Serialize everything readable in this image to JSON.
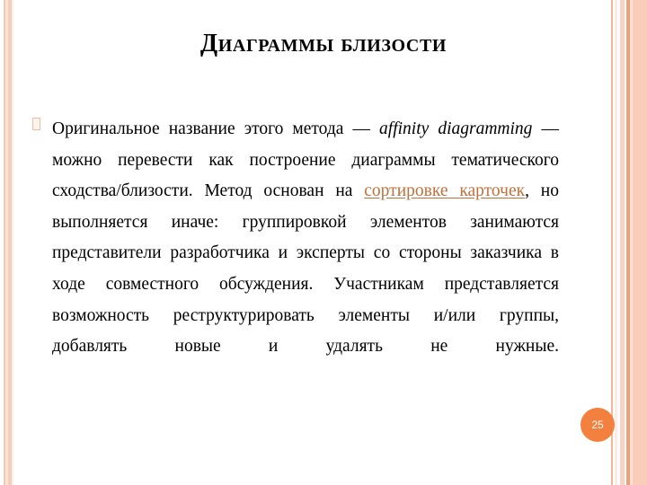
{
  "slide": {
    "title": "Диаграммы близости",
    "page_number": "25",
    "accent_color": "#f4803f",
    "link_color": "#c0703c",
    "stripe_color": "#f9cdb9",
    "background_color": "#ffffff"
  },
  "bullet": {
    "icon": "square-bullet-icon",
    "glyph": "❑",
    "color": "#f0bb9e"
  },
  "content": {
    "segments": [
      {
        "text": "Оригинальное название этого метода — ",
        "style": "normal"
      },
      {
        "text": "affinity diagramming",
        "style": "italic"
      },
      {
        "text": " — можно перевести как построение диаграммы тематического сходства/близости. Метод основан на ",
        "style": "normal"
      },
      {
        "text": "сортировке карточек",
        "style": "link"
      },
      {
        "text": ", но выполняется иначе: группировкой элементов занимаются представители разработчика и эксперты со стороны заказчика в ходе совместного обсуждения. Участникам представляется возможность реструктурировать элементы и/или группы, добавлять новые и удалять не нужные.",
        "style": "normal"
      }
    ],
    "plain_text": "Оригинальное название этого метода — affinity diagramming — можно перевести как построение диаграммы тематического сходства/близости. Метод основан на сортировке карточек, но выполняется иначе: группировкой элементов занимаются представители разработчика и эксперты со стороны заказчика в ходе совместного обсуждения. Участникам представляется возможность реструктурировать элементы и/или группы, добавлять новые и удалять не нужные."
  }
}
